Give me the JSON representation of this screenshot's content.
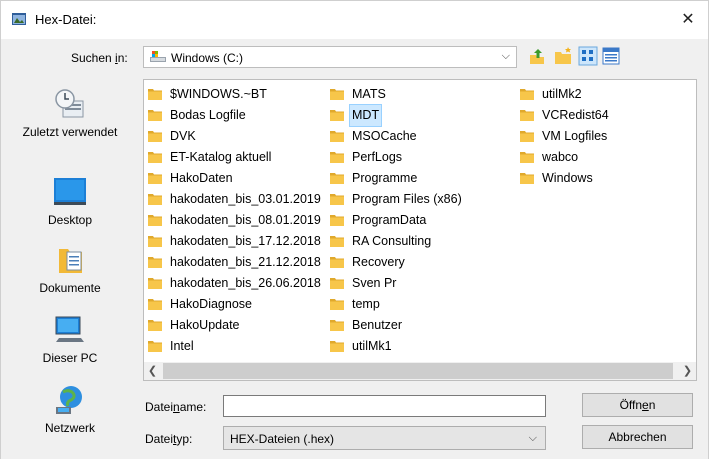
{
  "window": {
    "title": "Hex-Datei:",
    "close_glyph": "✕"
  },
  "toolbar": {
    "lookin_label_pre": "Suchen ",
    "lookin_label_acc": "i",
    "lookin_label_post": "n:",
    "lookin_value": "Windows (C:)",
    "chevron": "⌵",
    "buttons": [
      "up-folder-icon",
      "new-folder-icon",
      "view-menu-icon",
      "details-view-icon"
    ]
  },
  "places": [
    {
      "label": "Zuletzt verwendet",
      "icon": "recent-places-icon"
    },
    {
      "label": "Desktop",
      "icon": "desktop-icon"
    },
    {
      "label": "Dokumente",
      "icon": "documents-icon"
    },
    {
      "label": "Dieser PC",
      "icon": "this-pc-icon"
    },
    {
      "label": "Netzwerk",
      "icon": "network-icon"
    }
  ],
  "files": {
    "col1": [
      "$WINDOWS.~BT",
      "Bodas Logfile",
      "DVK",
      "ET-Katalog aktuell",
      "HakoDaten",
      "hakodaten_bis_03.01.2019",
      "hakodaten_bis_08.01.2019",
      "hakodaten_bis_17.12.2018",
      "hakodaten_bis_21.12.2018",
      "hakodaten_bis_26.06.2018",
      "HakoDiagnose",
      "HakoUpdate",
      "Intel"
    ],
    "col2": [
      "MATS",
      "MDT",
      "MSOCache",
      "PerfLogs",
      "Programme",
      "Program Files (x86)",
      "ProgramData",
      "RA Consulting",
      "Recovery",
      "Sven Pr",
      "temp",
      "Benutzer",
      "utilMk1"
    ],
    "col3": [
      "utilMk2",
      "VCRedist64",
      "VM Logfiles",
      "wabco",
      "Windows"
    ],
    "selected": "MDT"
  },
  "scrollbar": {
    "left": "❮",
    "right": "❯"
  },
  "filename": {
    "label_pre": "Datei",
    "label_acc": "n",
    "label_post": "ame:",
    "value": ""
  },
  "filetype": {
    "label_pre": "Datei",
    "label_acc": "t",
    "label_post": "yp:",
    "value": "HEX-Dateien (.hex)"
  },
  "buttons": {
    "open_pre": "Öffn",
    "open_acc": "e",
    "open_post": "n",
    "cancel": "Abbrechen"
  },
  "colors": {
    "folder": "#f7c64a",
    "folder_dark": "#e0a92c",
    "selection": "#cce8ff"
  }
}
